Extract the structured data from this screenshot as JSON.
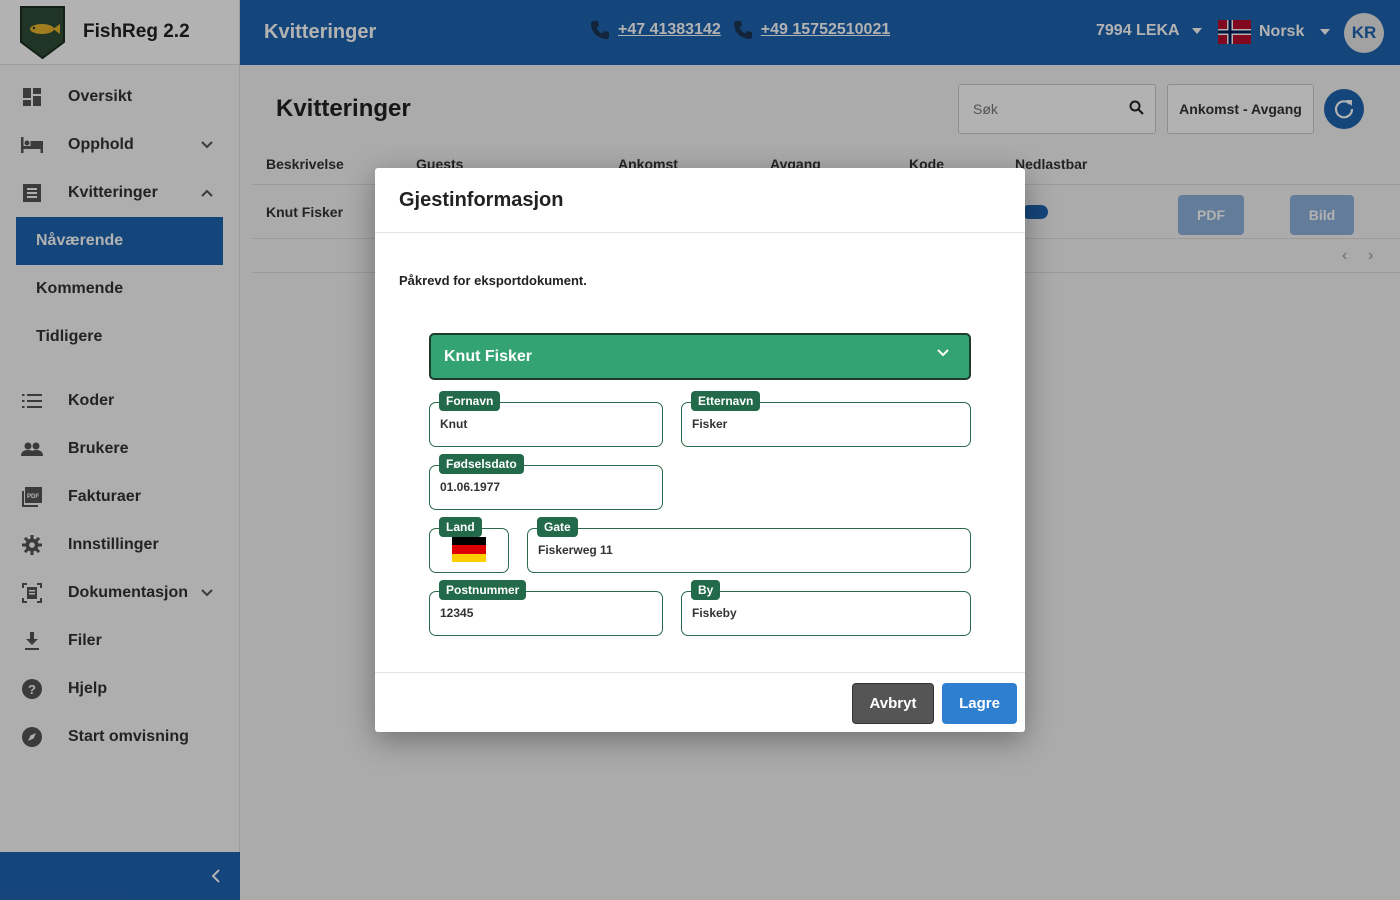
{
  "app": {
    "name": "FishReg 2.2"
  },
  "sidebar": {
    "items": [
      {
        "label": "Oversikt",
        "icon": "dashboard-icon"
      },
      {
        "label": "Opphold",
        "icon": "bed-icon"
      },
      {
        "label": "Kvitteringer",
        "icon": "receipt-icon"
      }
    ],
    "subitems": [
      {
        "label": "Nåværende",
        "active": true
      },
      {
        "label": "Kommende"
      },
      {
        "label": "Tidligere"
      }
    ],
    "items2": [
      {
        "label": "Koder",
        "icon": "list-icon"
      },
      {
        "label": "Brukere",
        "icon": "people-icon"
      },
      {
        "label": "Fakturaer",
        "icon": "pdf-icon"
      },
      {
        "label": "Innstillinger",
        "icon": "gear-icon"
      },
      {
        "label": "Dokumentasjon",
        "icon": "document-icon"
      },
      {
        "label": "Filer",
        "icon": "download-icon"
      },
      {
        "label": "Hjelp",
        "icon": "help-icon"
      },
      {
        "label": "Start omvisning",
        "icon": "compass-icon"
      }
    ]
  },
  "topbar": {
    "title": "Kvitteringer",
    "phone1": "+47 41383142",
    "phone2": "+49 15752510021",
    "location": "7994 LEKA",
    "language": "Norsk",
    "avatar": "KR"
  },
  "main": {
    "heading": "Kvitteringer",
    "search_placeholder": "Søk",
    "range_label": "Ankomst - Avgang",
    "columns": [
      "Beskrivelse",
      "Guests",
      "Ankomst",
      "Avgang",
      "Kode",
      "Nedlastbar"
    ],
    "row": {
      "beskrivelse": "Knut Fisker"
    },
    "pdf_label": "PDF",
    "bild_label": "Bild"
  },
  "modal": {
    "title": "Gjestinformasjon",
    "subtitle": "Påkrevd for eksportdokument.",
    "selected_guest": "Knut Fisker",
    "fields": {
      "fornavn": {
        "label": "Fornavn",
        "value": "Knut"
      },
      "etternavn": {
        "label": "Etternavn",
        "value": "Fisker"
      },
      "fodselsdato": {
        "label": "Fødselsdato",
        "value": "01.06.1977"
      },
      "land": {
        "label": "Land",
        "flag": "de-flag"
      },
      "gate": {
        "label": "Gate",
        "value": "Fiskerweg 11"
      },
      "postnummer": {
        "label": "Postnummer",
        "value": "12345"
      },
      "by": {
        "label": "By",
        "value": "Fiskeby"
      }
    },
    "cancel_label": "Avbryt",
    "save_label": "Lagre"
  },
  "colors": {
    "primary": "#1e63b0",
    "green": "#34a373",
    "label_green": "#236a4b"
  }
}
